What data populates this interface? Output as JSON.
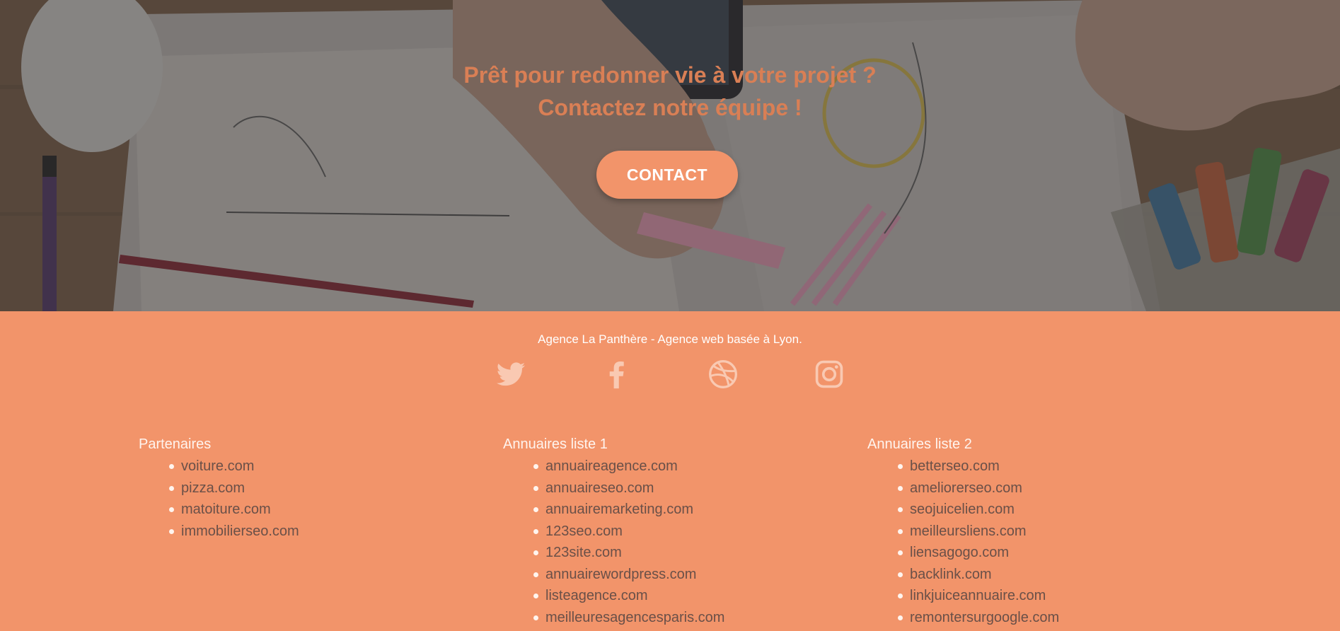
{
  "hero": {
    "title_line1": "Prêt pour redonner vie à votre projet ?",
    "title_line2": "Contactez notre équipe !",
    "contact_label": "CONTACT"
  },
  "footer": {
    "tagline": "Agence La Panthère - Agence web basée à Lyon.",
    "social_icons": [
      "twitter-icon",
      "facebook-icon",
      "dribbble-icon",
      "instagram-icon"
    ],
    "columns": [
      {
        "title": "Partenaires",
        "links": [
          "voiture.com",
          "pizza.com",
          "matoiture.com",
          "immobilierseo.com"
        ]
      },
      {
        "title": "Annuaires liste 1",
        "links": [
          "annuaireagence.com",
          "annuaireseo.com",
          "annuairemarketing.com",
          "123seo.com",
          "123site.com",
          "annuairewordpress.com",
          "listeagence.com",
          "meilleuresagencesparis.com"
        ]
      },
      {
        "title": "Annuaires liste 2",
        "links": [
          "betterseo.com",
          "ameliorerseo.com",
          "seojuicelien.com",
          "meilleursliens.com",
          "liensagogo.com",
          "backlink.com",
          "linkjuiceannuaire.com",
          "remontersurgoogle.com"
        ]
      }
    ]
  },
  "colors": {
    "accent": "#f2946a",
    "hero_title": "#d97f55",
    "link_text": "#6a5048"
  }
}
